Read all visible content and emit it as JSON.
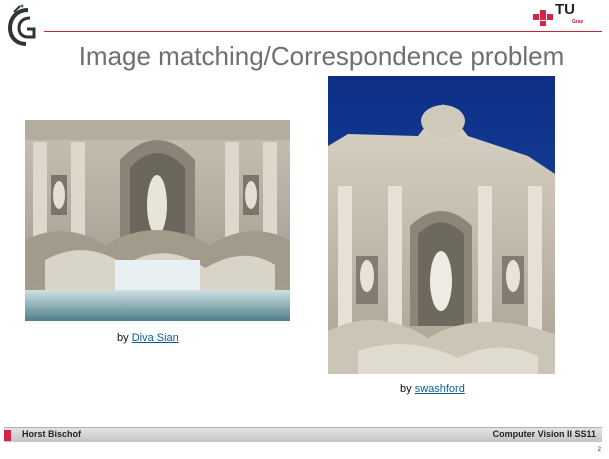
{
  "header": {
    "title": "Image matching/Correspondence problem",
    "logo_text": "TU",
    "logo_subtext": "Graz",
    "brand_color": "#cc1f3c"
  },
  "images": {
    "left": {
      "caption_prefix": "by",
      "caption_link": "Diva Sian"
    },
    "right": {
      "caption_prefix": "by",
      "caption_link": "swashford"
    }
  },
  "footer": {
    "author": "Horst Bischof",
    "course": "Computer Vision II SS11",
    "page_number": "2"
  }
}
